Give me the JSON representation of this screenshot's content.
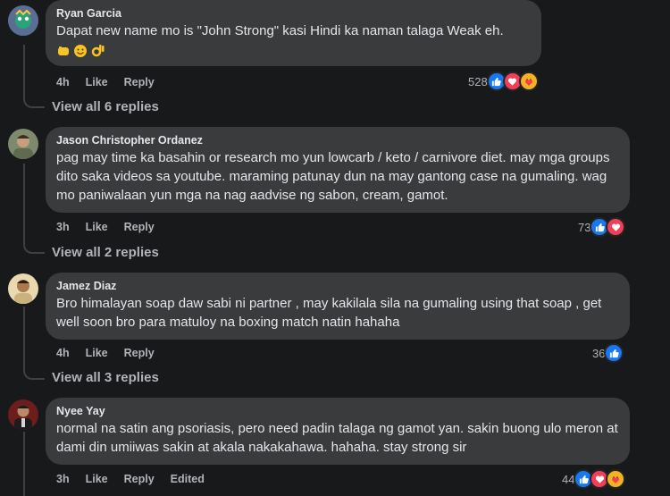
{
  "comments": [
    {
      "author": "Ryan Garcia",
      "text": "Dapat new name mo is \"John Strong\" kasi Hindi ka naman talaga Weak eh.",
      "emojis": [
        "fist-icon",
        "smile-icon",
        "ok-hand-icon"
      ],
      "time": "4h",
      "like": "Like",
      "reply": "Reply",
      "reaction_count": "528",
      "reactions": [
        "like",
        "love",
        "care"
      ],
      "view_replies": "View all 6 replies"
    },
    {
      "author": "Jason Christopher Ordanez",
      "text": "pag may time ka basahin or research mo yun lowcarb / keto / carnivore diet. may mga groups dito saka videos sa youtube. maraming patunay dun na may gantong case na gumaling. wag mo paniwalaan yun mga na nag aadvise ng sabon, cream, gamot.",
      "time": "3h",
      "like": "Like",
      "reply": "Reply",
      "reaction_count": "73",
      "reactions": [
        "like",
        "love"
      ],
      "view_replies": "View all 2 replies"
    },
    {
      "author": "Jamez Diaz",
      "text": "Bro himalayan soap daw sabi ni partner , may kakilala sila na gumaling using that soap , get well soon bro para matuloy na boxing match natin hahaha",
      "time": "4h",
      "like": "Like",
      "reply": "Reply",
      "reaction_count": "36",
      "reactions": [
        "like"
      ],
      "view_replies": "View all 3 replies"
    },
    {
      "author": "Nyee Yay",
      "text": "normal na satin ang psoriasis, pero need padin talaga ng gamot yan. sakin buong ulo meron at dami din umiiwas sakin at akala nakakahawa. hahaha. stay strong sir",
      "time": "3h",
      "like": "Like",
      "reply": "Reply",
      "edited": "Edited",
      "reaction_count": "44",
      "reactions": [
        "like",
        "love",
        "care"
      ]
    }
  ],
  "colors": {
    "background": "#18191a",
    "bubble": "#3a3b3c",
    "muted": "#b0b3b8",
    "like": "#1877f2",
    "love": "#f33e58",
    "care": "#f7b125"
  }
}
